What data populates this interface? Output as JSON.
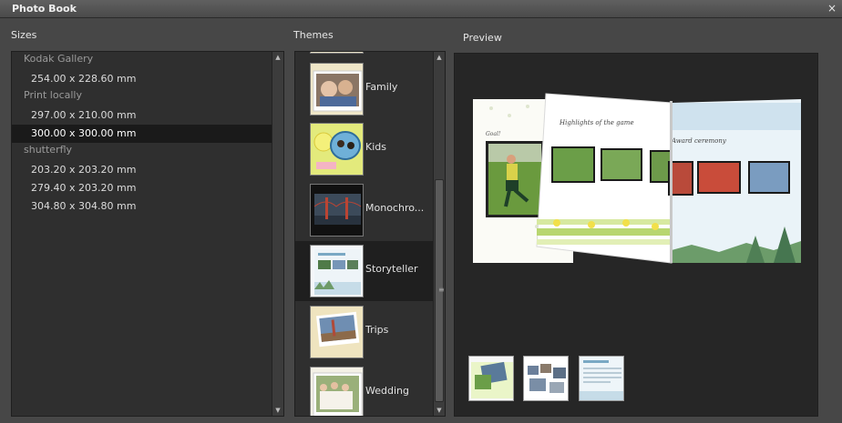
{
  "window": {
    "title": "Photo Book",
    "close_glyph": "×"
  },
  "labels": {
    "sizes": "Sizes",
    "themes": "Themes",
    "preview": "Preview"
  },
  "sizes": {
    "groups": [
      {
        "name": "Kodak Gallery",
        "items": [
          "254.00 x 228.60 mm"
        ]
      },
      {
        "name": "Print locally",
        "items": [
          "297.00 x 210.00 mm",
          "300.00 x 300.00 mm"
        ]
      },
      {
        "name": "shutterfly",
        "items": [
          "203.20 x 203.20 mm",
          "279.40 x 203.20 mm",
          "304.80 x 304.80 mm"
        ]
      }
    ],
    "selected": "300.00 x 300.00 mm"
  },
  "themes": {
    "items": [
      "Family",
      "Kids",
      "Monochro...",
      "Storyteller",
      "Trips",
      "Wedding"
    ],
    "selected": "Storyteller"
  },
  "preview": {
    "left_page_caption": "Goal!",
    "heading": "Highlights of the game",
    "right_heading": "Award ceremony",
    "page_thumbnail_icons": [
      "cover-page-thumbnail-icon",
      "spread-page-thumbnail-icon",
      "text-page-thumbnail-icon"
    ]
  },
  "colors": {
    "window_bg": "#474747",
    "panel_bg": "#2f2f2f",
    "preview_bg": "#262626",
    "selection_bg": "#1a1a1a"
  }
}
